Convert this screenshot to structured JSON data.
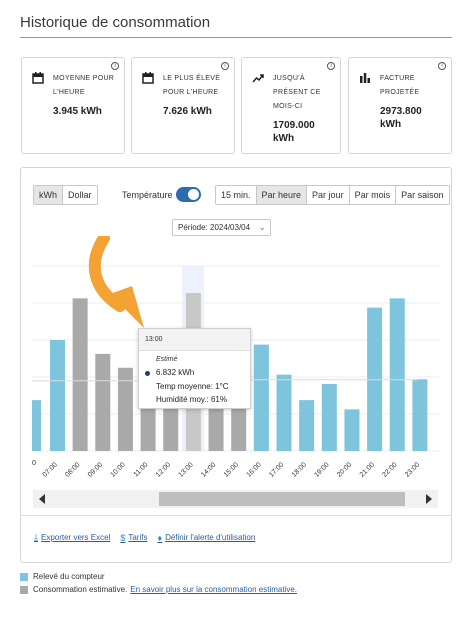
{
  "page_title": "Historique de consommation",
  "cards": [
    {
      "label": "MOYENNE POUR L'HEURE",
      "value": "3.945 kWh",
      "icon": "calendar-icon"
    },
    {
      "label": "LE PLUS ÉLEVÉ POUR L'HEURE",
      "value": "7.626 kWh",
      "icon": "calendar-icon"
    },
    {
      "label": "JUSQU'À PRÉSENT CE MOIS-CI",
      "value": "1709.000 kWh",
      "icon": "trend-up-icon"
    },
    {
      "label": "FACTURE PROJETÉE",
      "value": "2973.800 kWh",
      "icon": "bar-chart-icon"
    }
  ],
  "unit_toggle": [
    "kWh",
    "Dollar"
  ],
  "temperature_label": "Température",
  "temperature_on": true,
  "interval_tabs": [
    "15 min.",
    "Par heure",
    "Par jour",
    "Par mois",
    "Par saison"
  ],
  "active_interval": "Par heure",
  "period": "Période: 2024/03/04",
  "tooltip": {
    "time": "13:00",
    "estimated_label": "Estimé",
    "value": "6.832 kWh",
    "temp": "Temp moyenne: 1°C",
    "humidity": "Humidité moy.: 61%"
  },
  "links": {
    "export": "Exporter vers Excel",
    "rates": "Tarifs",
    "alert": "Définir l'alerte d'utilisation"
  },
  "legend": {
    "meter": "Relevé du compteur",
    "estimated": "Consommation estimative.",
    "learn_more": "En savoir plus sur la consommation estimative."
  },
  "colors": {
    "meter": "#7ec4dc",
    "estimated": "#a9a9a9",
    "accent": "#e97b3a",
    "toggle": "#2b6cb0"
  },
  "chart_data": {
    "type": "bar",
    "categories": [
      "07:00",
      "08:00",
      "09:00",
      "10:00",
      "11:00",
      "12:00",
      "13:00",
      "14:00",
      "15:00",
      "16:00",
      "17:00",
      "18:00",
      "19:00",
      "20:00",
      "21:00",
      "22:00",
      "23:00"
    ],
    "series": [
      {
        "name": "Relevé du compteur",
        "values": [
          4.8,
          null,
          null,
          null,
          null,
          null,
          null,
          null,
          null,
          4.6,
          3.3,
          2.2,
          2.9,
          1.8,
          6.2,
          6.6,
          3.1
        ]
      },
      {
        "name": "Consommation estimative",
        "values": [
          null,
          6.6,
          4.2,
          3.6,
          3.0,
          3.2,
          6.832,
          3.5,
          3.4,
          null,
          null,
          null,
          null,
          null,
          null,
          null,
          null
        ]
      }
    ],
    "first_partial": {
      "category": "06:00",
      "meter": 2.2
    },
    "highlighted": "13:00",
    "ylim": [
      0,
      8
    ],
    "grid": true
  }
}
